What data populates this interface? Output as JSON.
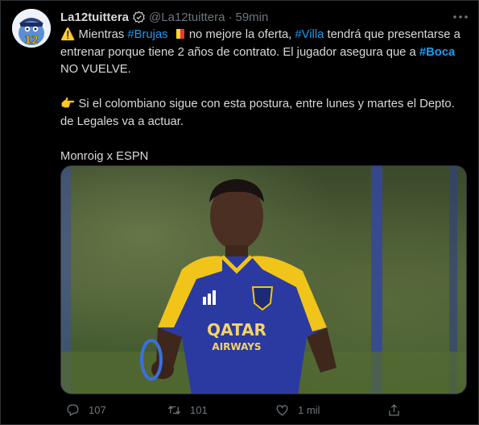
{
  "tweet": {
    "name": "La12tuittera",
    "handle": "@La12tuittera",
    "separator": "·",
    "time": "59min",
    "text": {
      "l1_warning": "⚠️",
      "l1_a": " Mientras ",
      "tag_brujas": "#Brujas",
      "l1_b": " no mejore la oferta, ",
      "tag_villa": "#Villa",
      "l1_c": " tendrá que presentarse a entrenar porque tiene 2 años de contrato. El jugador asegura que a ",
      "tag_boca": "#Boca",
      "l1_d": " NO VUELVE.",
      "l2_pointer": "👉",
      "l2": " Si el colombiano sigue con esta postura, entre lunes y martes el Depto. de Legales va a actuar.",
      "l3": "Monroig x ESPN"
    },
    "image": {
      "sponsor_line1": "QATAR",
      "sponsor_line2": "AIRWAYS"
    },
    "actions": {
      "replies": "107",
      "retweets": "101",
      "likes": "1 mil"
    }
  },
  "colors": {
    "background": "#000000",
    "text": "#d9d9d9",
    "muted": "#6e767d",
    "link": "#1d9bf0",
    "flag": [
      "#000000",
      "#fdda24",
      "#ef3340"
    ]
  },
  "icons": [
    "verified-icon",
    "more-icon",
    "reply-icon",
    "retweet-icon",
    "like-icon",
    "share-icon"
  ]
}
